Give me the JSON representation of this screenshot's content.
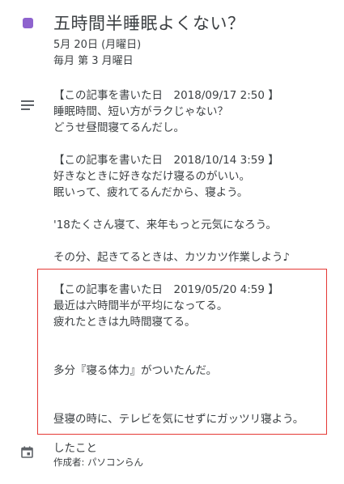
{
  "event": {
    "title": "五時間半睡眠よくない？",
    "date": "5月 20日 (月曜日)",
    "recurrence": "毎月 第 3 月曜日",
    "color": "#8e63ce"
  },
  "description": {
    "lines": [
      "【この記事を書いた日　2018/09/17  2:50 】",
      "睡眠時間、短い方がラクじゃない？",
      "どうせ昼間寝てるんだし。",
      "",
      "【この記事を書いた日　2018/10/14  3:59 】",
      "好きなときに好きなだけ寝るのがいい。",
      "眠いって、疲れてるんだから、寝よう。",
      "",
      "'18たくさん寝て、来年もっと元気になろう。",
      "",
      "その分、起きてるときは、カツカツ作業しよう♪",
      "",
      "【この記事を書いた日　2019/05/20  4:59 】",
      "最近は六時間半が平均になってる。",
      "疲れたときは九時間寝てる。",
      "",
      "",
      "多分『寝る体力』がついたんだ。",
      "",
      "",
      "昼寝の時に、テレビを気にせずにガッツリ寝よう。"
    ]
  },
  "calendar": {
    "name": "したこと",
    "creator_label": "作成者:",
    "creator": "パソコンらん"
  },
  "highlight_color": "#e53935"
}
